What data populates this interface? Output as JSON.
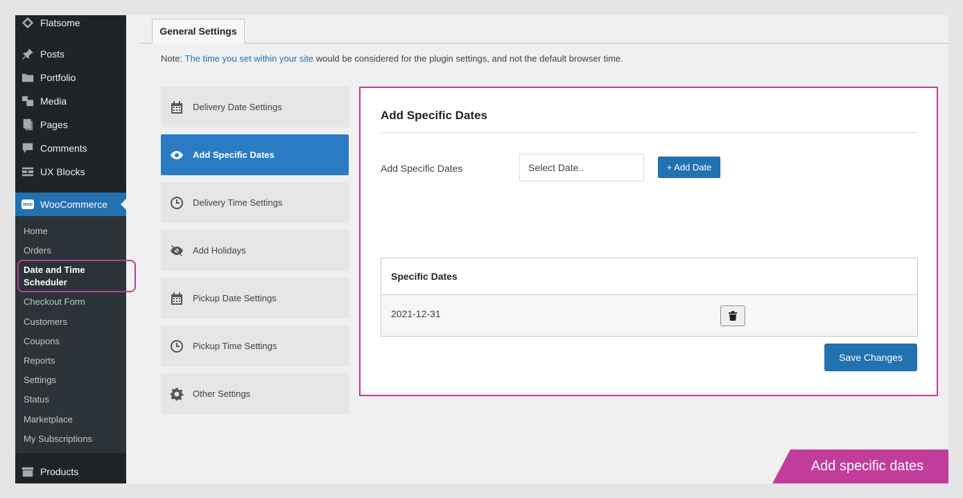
{
  "sidebar": {
    "top_items": [
      {
        "label": "Flatsome",
        "icon": "flatsome-diamond-icon"
      },
      {
        "label": "Posts",
        "icon": "pin-icon"
      },
      {
        "label": "Portfolio",
        "icon": "folder-icon"
      },
      {
        "label": "Media",
        "icon": "media-icon"
      },
      {
        "label": "Pages",
        "icon": "pages-icon"
      },
      {
        "label": "Comments",
        "icon": "comment-icon"
      },
      {
        "label": "UX Blocks",
        "icon": "grid-icon"
      }
    ],
    "woocommerce": {
      "label": "WooCommerce",
      "badge": "woo"
    },
    "submenu": [
      "Home",
      "Orders",
      "Date and Time Scheduler",
      "Checkout Form",
      "Customers",
      "Coupons",
      "Reports",
      "Settings",
      "Status",
      "Marketplace",
      "My Subscriptions"
    ],
    "current_submenu": "Date and Time Scheduler",
    "products": {
      "label": "Products",
      "icon": "archive-icon"
    }
  },
  "tabs": {
    "general": "General Settings"
  },
  "note": {
    "prefix": "Note: ",
    "link": "The time you set within your site",
    "suffix": " would be considered for the plugin settings, and not the default browser time."
  },
  "settings_nav": [
    {
      "label": "Delivery Date Settings",
      "icon": "calendar-icon"
    },
    {
      "label": "Add Specific Dates",
      "icon": "eye-icon"
    },
    {
      "label": "Delivery Time Settings",
      "icon": "clock-icon"
    },
    {
      "label": "Add Holidays",
      "icon": "eye-slash-icon"
    },
    {
      "label": "Pickup Date Settings",
      "icon": "calendar-icon"
    },
    {
      "label": "Pickup Time Settings",
      "icon": "clock-icon"
    },
    {
      "label": "Other Settings",
      "icon": "gear-icon"
    }
  ],
  "active_nav": "Add Specific Dates",
  "panel": {
    "title": "Add Specific Dates",
    "field_label": "Add Specific Dates",
    "date_placeholder": "Select Date..",
    "add_button": "+ Add Date",
    "table_header": "Specific Dates",
    "rows": [
      {
        "date": "2021-12-31"
      }
    ],
    "save_button": "Save Changes"
  },
  "ribbon": {
    "text": "Add specific dates"
  },
  "colors": {
    "sidebar_bg": "#1d2327",
    "accent": "#2271b1",
    "active_nav": "#2a7bc4",
    "highlight": "#c23c9b"
  }
}
